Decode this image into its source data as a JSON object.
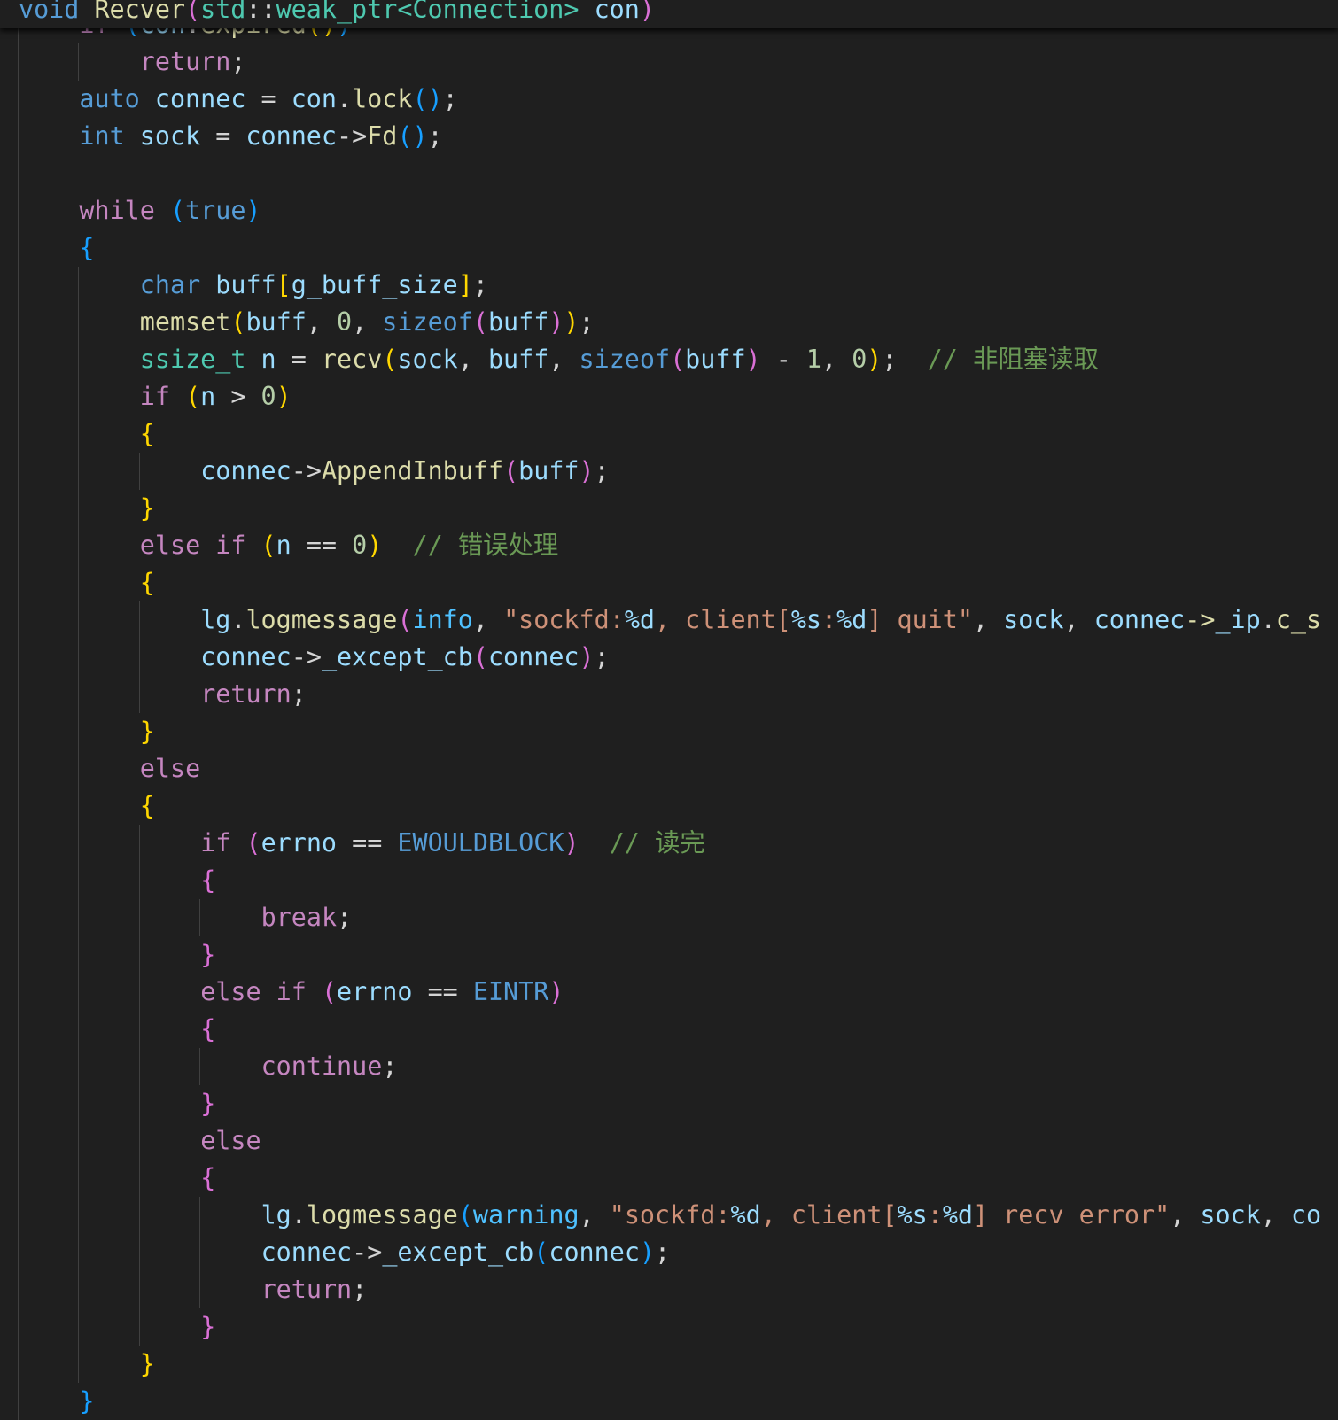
{
  "colors": {
    "background": "#1f1f1f",
    "keyword": "#569cd6",
    "control": "#c586c0",
    "variable": "#9cdcfe",
    "function": "#dcdcaa",
    "type": "#4ec9b0",
    "string": "#ce9178",
    "comment": "#6a9955",
    "bracket_1": "#ffd700",
    "bracket_2": "#da70d6",
    "bracket_3": "#179fff"
  },
  "editor": {
    "sticky_header": {
      "tokens": [
        [
          "void",
          "k"
        ],
        [
          " ",
          "p"
        ],
        [
          "Recver",
          "f"
        ],
        [
          "(",
          "b2"
        ],
        [
          "std",
          "t"
        ],
        [
          "::",
          "p"
        ],
        [
          "weak_ptr",
          "t"
        ],
        [
          "<",
          "t"
        ],
        [
          "Connection",
          "t"
        ],
        [
          ">",
          "t"
        ],
        [
          " ",
          "p"
        ],
        [
          "con",
          "v"
        ],
        [
          ")",
          "b2"
        ]
      ]
    },
    "lines": [
      {
        "indent": 1,
        "tokens": [
          [
            "if",
            "c"
          ],
          [
            " ",
            "p"
          ],
          [
            "(",
            "b3"
          ],
          [
            "con",
            "v"
          ],
          [
            ".",
            "p"
          ],
          [
            "expired",
            "f"
          ],
          [
            "(",
            "b1"
          ],
          [
            ")",
            "b1"
          ],
          [
            ")",
            "b3"
          ]
        ]
      },
      {
        "indent": 2,
        "tokens": [
          [
            "return",
            "c"
          ],
          [
            ";",
            "p"
          ]
        ]
      },
      {
        "indent": 1,
        "tokens": [
          [
            "auto",
            "k"
          ],
          [
            " ",
            "p"
          ],
          [
            "connec",
            "v"
          ],
          [
            " = ",
            "p"
          ],
          [
            "con",
            "v"
          ],
          [
            ".",
            "p"
          ],
          [
            "lock",
            "f"
          ],
          [
            "(",
            "b3"
          ],
          [
            ")",
            "b3"
          ],
          [
            ";",
            "p"
          ]
        ]
      },
      {
        "indent": 1,
        "tokens": [
          [
            "int",
            "k"
          ],
          [
            " ",
            "p"
          ],
          [
            "sock",
            "v"
          ],
          [
            " = ",
            "p"
          ],
          [
            "connec",
            "v"
          ],
          [
            "->",
            "p"
          ],
          [
            "Fd",
            "f"
          ],
          [
            "(",
            "b3"
          ],
          [
            ")",
            "b3"
          ],
          [
            ";",
            "p"
          ]
        ]
      },
      {
        "indent": 1,
        "tokens": []
      },
      {
        "indent": 1,
        "tokens": [
          [
            "while",
            "c"
          ],
          [
            " ",
            "p"
          ],
          [
            "(",
            "b3"
          ],
          [
            "true",
            "k"
          ],
          [
            ")",
            "b3"
          ]
        ]
      },
      {
        "indent": 1,
        "tokens": [
          [
            "{",
            "b3"
          ]
        ]
      },
      {
        "indent": 2,
        "tokens": [
          [
            "char",
            "k"
          ],
          [
            " ",
            "p"
          ],
          [
            "buff",
            "v"
          ],
          [
            "[",
            "b1"
          ],
          [
            "g_buff_size",
            "v"
          ],
          [
            "]",
            "b1"
          ],
          [
            ";",
            "p"
          ]
        ]
      },
      {
        "indent": 2,
        "tokens": [
          [
            "memset",
            "f"
          ],
          [
            "(",
            "b1"
          ],
          [
            "buff",
            "v"
          ],
          [
            ", ",
            "p"
          ],
          [
            "0",
            "n"
          ],
          [
            ", ",
            "p"
          ],
          [
            "sizeof",
            "k"
          ],
          [
            "(",
            "b2"
          ],
          [
            "buff",
            "v"
          ],
          [
            ")",
            "b2"
          ],
          [
            ")",
            "b1"
          ],
          [
            ";",
            "p"
          ]
        ]
      },
      {
        "indent": 2,
        "tokens": [
          [
            "ssize_t",
            "t"
          ],
          [
            " ",
            "p"
          ],
          [
            "n",
            "v"
          ],
          [
            " = ",
            "p"
          ],
          [
            "recv",
            "f"
          ],
          [
            "(",
            "b1"
          ],
          [
            "sock",
            "v"
          ],
          [
            ", ",
            "p"
          ],
          [
            "buff",
            "v"
          ],
          [
            ", ",
            "p"
          ],
          [
            "sizeof",
            "k"
          ],
          [
            "(",
            "b2"
          ],
          [
            "buff",
            "v"
          ],
          [
            ")",
            "b2"
          ],
          [
            " - ",
            "p"
          ],
          [
            "1",
            "n"
          ],
          [
            ", ",
            "p"
          ],
          [
            "0",
            "n"
          ],
          [
            ")",
            "b1"
          ],
          [
            ";",
            "p"
          ],
          [
            "  // 非阻塞读取",
            "cm"
          ]
        ]
      },
      {
        "indent": 2,
        "tokens": [
          [
            "if",
            "c"
          ],
          [
            " ",
            "p"
          ],
          [
            "(",
            "b1"
          ],
          [
            "n",
            "v"
          ],
          [
            " > ",
            "p"
          ],
          [
            "0",
            "n"
          ],
          [
            ")",
            "b1"
          ]
        ]
      },
      {
        "indent": 2,
        "tokens": [
          [
            "{",
            "b1"
          ]
        ]
      },
      {
        "indent": 3,
        "tokens": [
          [
            "connec",
            "v"
          ],
          [
            "->",
            "p"
          ],
          [
            "AppendInbuff",
            "f"
          ],
          [
            "(",
            "b2"
          ],
          [
            "buff",
            "v"
          ],
          [
            ")",
            "b2"
          ],
          [
            ";",
            "p"
          ]
        ]
      },
      {
        "indent": 2,
        "tokens": [
          [
            "}",
            "b1"
          ]
        ]
      },
      {
        "indent": 2,
        "tokens": [
          [
            "else",
            "c"
          ],
          [
            " ",
            "p"
          ],
          [
            "if",
            "c"
          ],
          [
            " ",
            "p"
          ],
          [
            "(",
            "b1"
          ],
          [
            "n",
            "v"
          ],
          [
            " == ",
            "p"
          ],
          [
            "0",
            "n"
          ],
          [
            ")",
            "b1"
          ],
          [
            "  // 错误处理",
            "cm"
          ]
        ]
      },
      {
        "indent": 2,
        "tokens": [
          [
            "{",
            "b1"
          ]
        ]
      },
      {
        "indent": 3,
        "tokens": [
          [
            "lg",
            "v"
          ],
          [
            ".",
            "p"
          ],
          [
            "logmessage",
            "f"
          ],
          [
            "(",
            "b2"
          ],
          [
            "info",
            "en"
          ],
          [
            ", ",
            "p"
          ],
          [
            "\"sockfd:",
            "s"
          ],
          [
            "%d",
            "e"
          ],
          [
            ", client[",
            "s"
          ],
          [
            "%s",
            "e"
          ],
          [
            ":",
            "s"
          ],
          [
            "%d",
            "e"
          ],
          [
            "] quit\"",
            "s"
          ],
          [
            ", ",
            "p"
          ],
          [
            "sock",
            "v"
          ],
          [
            ", ",
            "p"
          ],
          [
            "connec",
            "v"
          ],
          [
            "->",
            "f"
          ],
          [
            "_ip",
            "v"
          ],
          [
            ".",
            "p"
          ],
          [
            "c_s",
            "f"
          ]
        ]
      },
      {
        "indent": 3,
        "tokens": [
          [
            "connec",
            "v"
          ],
          [
            "->",
            "p"
          ],
          [
            "_except_cb",
            "v"
          ],
          [
            "(",
            "b2"
          ],
          [
            "connec",
            "v"
          ],
          [
            ")",
            "b2"
          ],
          [
            ";",
            "p"
          ]
        ]
      },
      {
        "indent": 3,
        "tokens": [
          [
            "return",
            "c"
          ],
          [
            ";",
            "p"
          ]
        ]
      },
      {
        "indent": 2,
        "tokens": [
          [
            "}",
            "b1"
          ]
        ]
      },
      {
        "indent": 2,
        "tokens": [
          [
            "else",
            "c"
          ]
        ]
      },
      {
        "indent": 2,
        "tokens": [
          [
            "{",
            "b1"
          ]
        ]
      },
      {
        "indent": 3,
        "tokens": [
          [
            "if",
            "c"
          ],
          [
            " ",
            "p"
          ],
          [
            "(",
            "b2"
          ],
          [
            "errno",
            "v"
          ],
          [
            " == ",
            "p"
          ],
          [
            "EWOULDBLOCK",
            "m"
          ],
          [
            ")",
            "b2"
          ],
          [
            "  // 读完",
            "cm"
          ]
        ]
      },
      {
        "indent": 3,
        "tokens": [
          [
            "{",
            "b2"
          ]
        ]
      },
      {
        "indent": 4,
        "tokens": [
          [
            "break",
            "c"
          ],
          [
            ";",
            "p"
          ]
        ]
      },
      {
        "indent": 3,
        "tokens": [
          [
            "}",
            "b2"
          ]
        ]
      },
      {
        "indent": 3,
        "tokens": [
          [
            "else",
            "c"
          ],
          [
            " ",
            "p"
          ],
          [
            "if",
            "c"
          ],
          [
            " ",
            "p"
          ],
          [
            "(",
            "b2"
          ],
          [
            "errno",
            "v"
          ],
          [
            " == ",
            "p"
          ],
          [
            "EINTR",
            "m"
          ],
          [
            ")",
            "b2"
          ]
        ]
      },
      {
        "indent": 3,
        "tokens": [
          [
            "{",
            "b2"
          ]
        ]
      },
      {
        "indent": 4,
        "tokens": [
          [
            "continue",
            "c"
          ],
          [
            ";",
            "p"
          ]
        ]
      },
      {
        "indent": 3,
        "tokens": [
          [
            "}",
            "b2"
          ]
        ]
      },
      {
        "indent": 3,
        "tokens": [
          [
            "else",
            "c"
          ]
        ]
      },
      {
        "indent": 3,
        "tokens": [
          [
            "{",
            "b2"
          ]
        ]
      },
      {
        "indent": 4,
        "tokens": [
          [
            "lg",
            "v"
          ],
          [
            ".",
            "p"
          ],
          [
            "logmessage",
            "f"
          ],
          [
            "(",
            "b3"
          ],
          [
            "warning",
            "en"
          ],
          [
            ", ",
            "p"
          ],
          [
            "\"sockfd:",
            "s"
          ],
          [
            "%d",
            "e"
          ],
          [
            ", client[",
            "s"
          ],
          [
            "%s",
            "e"
          ],
          [
            ":",
            "s"
          ],
          [
            "%d",
            "e"
          ],
          [
            "] recv error\"",
            "s"
          ],
          [
            ", ",
            "p"
          ],
          [
            "sock",
            "v"
          ],
          [
            ", ",
            "p"
          ],
          [
            "co",
            "v"
          ]
        ]
      },
      {
        "indent": 4,
        "tokens": [
          [
            "connec",
            "v"
          ],
          [
            "->",
            "p"
          ],
          [
            "_except_cb",
            "v"
          ],
          [
            "(",
            "b3"
          ],
          [
            "connec",
            "v"
          ],
          [
            ")",
            "b3"
          ],
          [
            ";",
            "p"
          ]
        ]
      },
      {
        "indent": 4,
        "tokens": [
          [
            "return",
            "c"
          ],
          [
            ";",
            "p"
          ]
        ]
      },
      {
        "indent": 3,
        "tokens": [
          [
            "}",
            "b2"
          ]
        ]
      },
      {
        "indent": 2,
        "tokens": [
          [
            "}",
            "b1"
          ]
        ]
      },
      {
        "indent": 1,
        "tokens": [
          [
            "}",
            "b3"
          ]
        ]
      }
    ]
  }
}
